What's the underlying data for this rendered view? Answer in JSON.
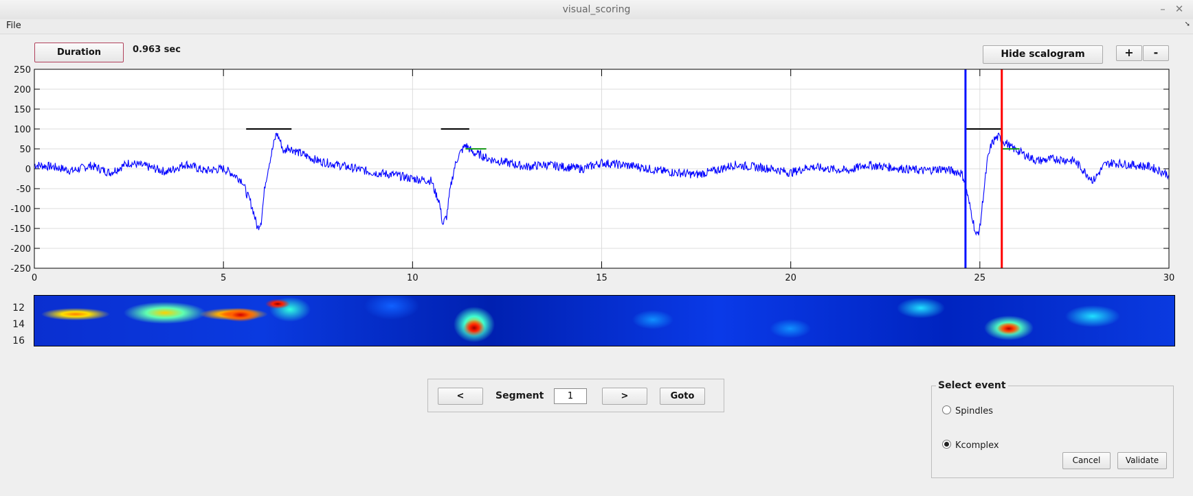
{
  "window": {
    "title": "visual_scoring"
  },
  "menu": {
    "file": "File"
  },
  "toolbar": {
    "duration_label": "Duration",
    "duration_value": "0.963 sec",
    "hide_scalogram_label": "Hide scalogram",
    "zoom_in_label": "+",
    "zoom_out_label": "-"
  },
  "chart_data": {
    "type": "line",
    "xlim": [
      0,
      30
    ],
    "ylim": [
      -250,
      250
    ],
    "x_ticks": [
      "0",
      "5",
      "10",
      "15",
      "20",
      "25",
      "30"
    ],
    "y_ticks": [
      "250",
      "200",
      "150",
      "100",
      "50",
      "0",
      "-50",
      "-100",
      "-150",
      "-200",
      "-250"
    ],
    "grid": true,
    "series": [
      {
        "color": "#0000ff",
        "x": [
          0,
          0.5,
          1,
          1.5,
          2,
          2.5,
          3,
          3.5,
          4,
          4.5,
          5,
          5.2,
          5.5,
          5.6,
          5.7,
          5.8,
          5.9,
          6.0,
          6.1,
          6.2,
          6.3,
          6.4,
          6.5,
          6.6,
          6.7,
          6.8,
          7.0,
          7.5,
          8,
          8.5,
          9,
          9.5,
          10,
          10.5,
          10.6,
          10.7,
          10.8,
          10.9,
          11.0,
          11.1,
          11.2,
          11.3,
          11.4,
          11.5,
          11.6,
          11.8,
          12,
          12.5,
          13,
          13.5,
          14,
          14.5,
          15,
          15.5,
          16,
          16.5,
          17,
          17.5,
          18,
          18.5,
          19,
          19.5,
          20,
          20.5,
          21,
          21.5,
          22,
          22.5,
          23,
          23.5,
          24,
          24.5,
          24.6,
          24.7,
          24.8,
          24.9,
          25.0,
          25.1,
          25.2,
          25.3,
          25.4,
          25.5,
          25.6,
          25.7,
          25.8,
          26.0,
          26.3,
          26.5,
          27,
          27.5,
          27.8,
          28,
          28.3,
          28.5,
          29,
          29.5,
          30
        ],
        "y": [
          10,
          5,
          -5,
          8,
          -10,
          15,
          5,
          -8,
          12,
          -5,
          0,
          -10,
          -30,
          -60,
          -80,
          -110,
          -150,
          -130,
          -40,
          10,
          50,
          90,
          70,
          40,
          55,
          50,
          40,
          20,
          10,
          0,
          -10,
          -15,
          -25,
          -30,
          -60,
          -80,
          -140,
          -120,
          -50,
          0,
          30,
          45,
          60,
          50,
          40,
          35,
          25,
          15,
          5,
          10,
          5,
          0,
          15,
          10,
          5,
          -5,
          -10,
          -15,
          -5,
          10,
          5,
          0,
          -10,
          5,
          0,
          -5,
          10,
          5,
          0,
          -5,
          0,
          -10,
          -30,
          -80,
          -120,
          -170,
          -150,
          -60,
          20,
          60,
          75,
          80,
          70,
          65,
          55,
          45,
          30,
          20,
          25,
          20,
          -10,
          -30,
          10,
          15,
          10,
          5,
          -15
        ]
      }
    ],
    "annotations": {
      "black_bars": [
        {
          "x0": 5.6,
          "x1": 6.8,
          "y": 100
        },
        {
          "x0": 10.75,
          "x1": 11.5,
          "y": 100
        },
        {
          "x0": 24.6,
          "x1": 25.6,
          "y": 100
        }
      ],
      "green_bars": [
        {
          "x0": 11.4,
          "x1": 11.95,
          "y": 50
        },
        {
          "x0": 25.6,
          "x1": 26.05,
          "y": 50
        }
      ],
      "blue_line_x": 24.62,
      "red_line_x": 25.58
    }
  },
  "scalogram": {
    "y_ticks": [
      "12",
      "14",
      "16"
    ]
  },
  "navigation": {
    "prev_label": "<",
    "segment_label": "Segment",
    "segment_value": "1",
    "next_label": ">",
    "goto_label": "Goto"
  },
  "event_panel": {
    "legend": "Select event",
    "options": [
      {
        "label": "Spindles",
        "selected": false
      },
      {
        "label": "Kcomplex",
        "selected": true
      }
    ],
    "cancel_label": "Cancel",
    "validate_label": "Validate"
  }
}
